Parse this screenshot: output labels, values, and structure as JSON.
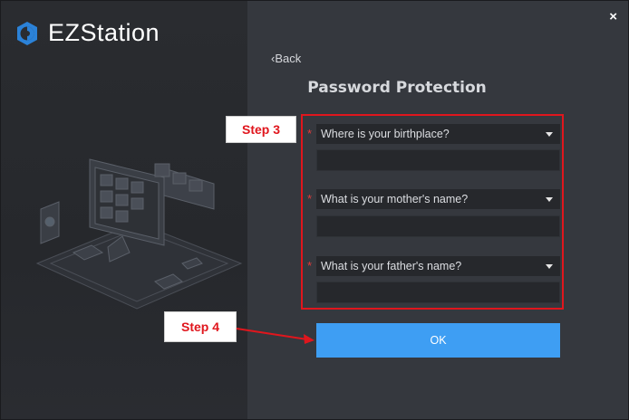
{
  "app": {
    "name": "EZStation"
  },
  "window": {
    "close_label": "×"
  },
  "nav": {
    "back_label": "‹Back"
  },
  "page": {
    "title": "Password Protection"
  },
  "questions": [
    {
      "required_mark": "*",
      "question": "Where is your birthplace?",
      "answer": ""
    },
    {
      "required_mark": "*",
      "question": "What is your mother's name?",
      "answer": ""
    },
    {
      "required_mark": "*",
      "question": "What is your father's name?",
      "answer": ""
    }
  ],
  "buttons": {
    "ok_label": "OK"
  },
  "annotations": {
    "step3": "Step 3",
    "step4": "Step 4",
    "highlight_color": "#e0161d"
  },
  "colors": {
    "accent": "#3e9ef3",
    "background": "#35383e",
    "field": "#26282c",
    "required": "#e23a3a"
  },
  "icons": {
    "logo": "ezstation-logo-icon",
    "close": "close-icon",
    "dropdown": "chevron-down-icon"
  }
}
